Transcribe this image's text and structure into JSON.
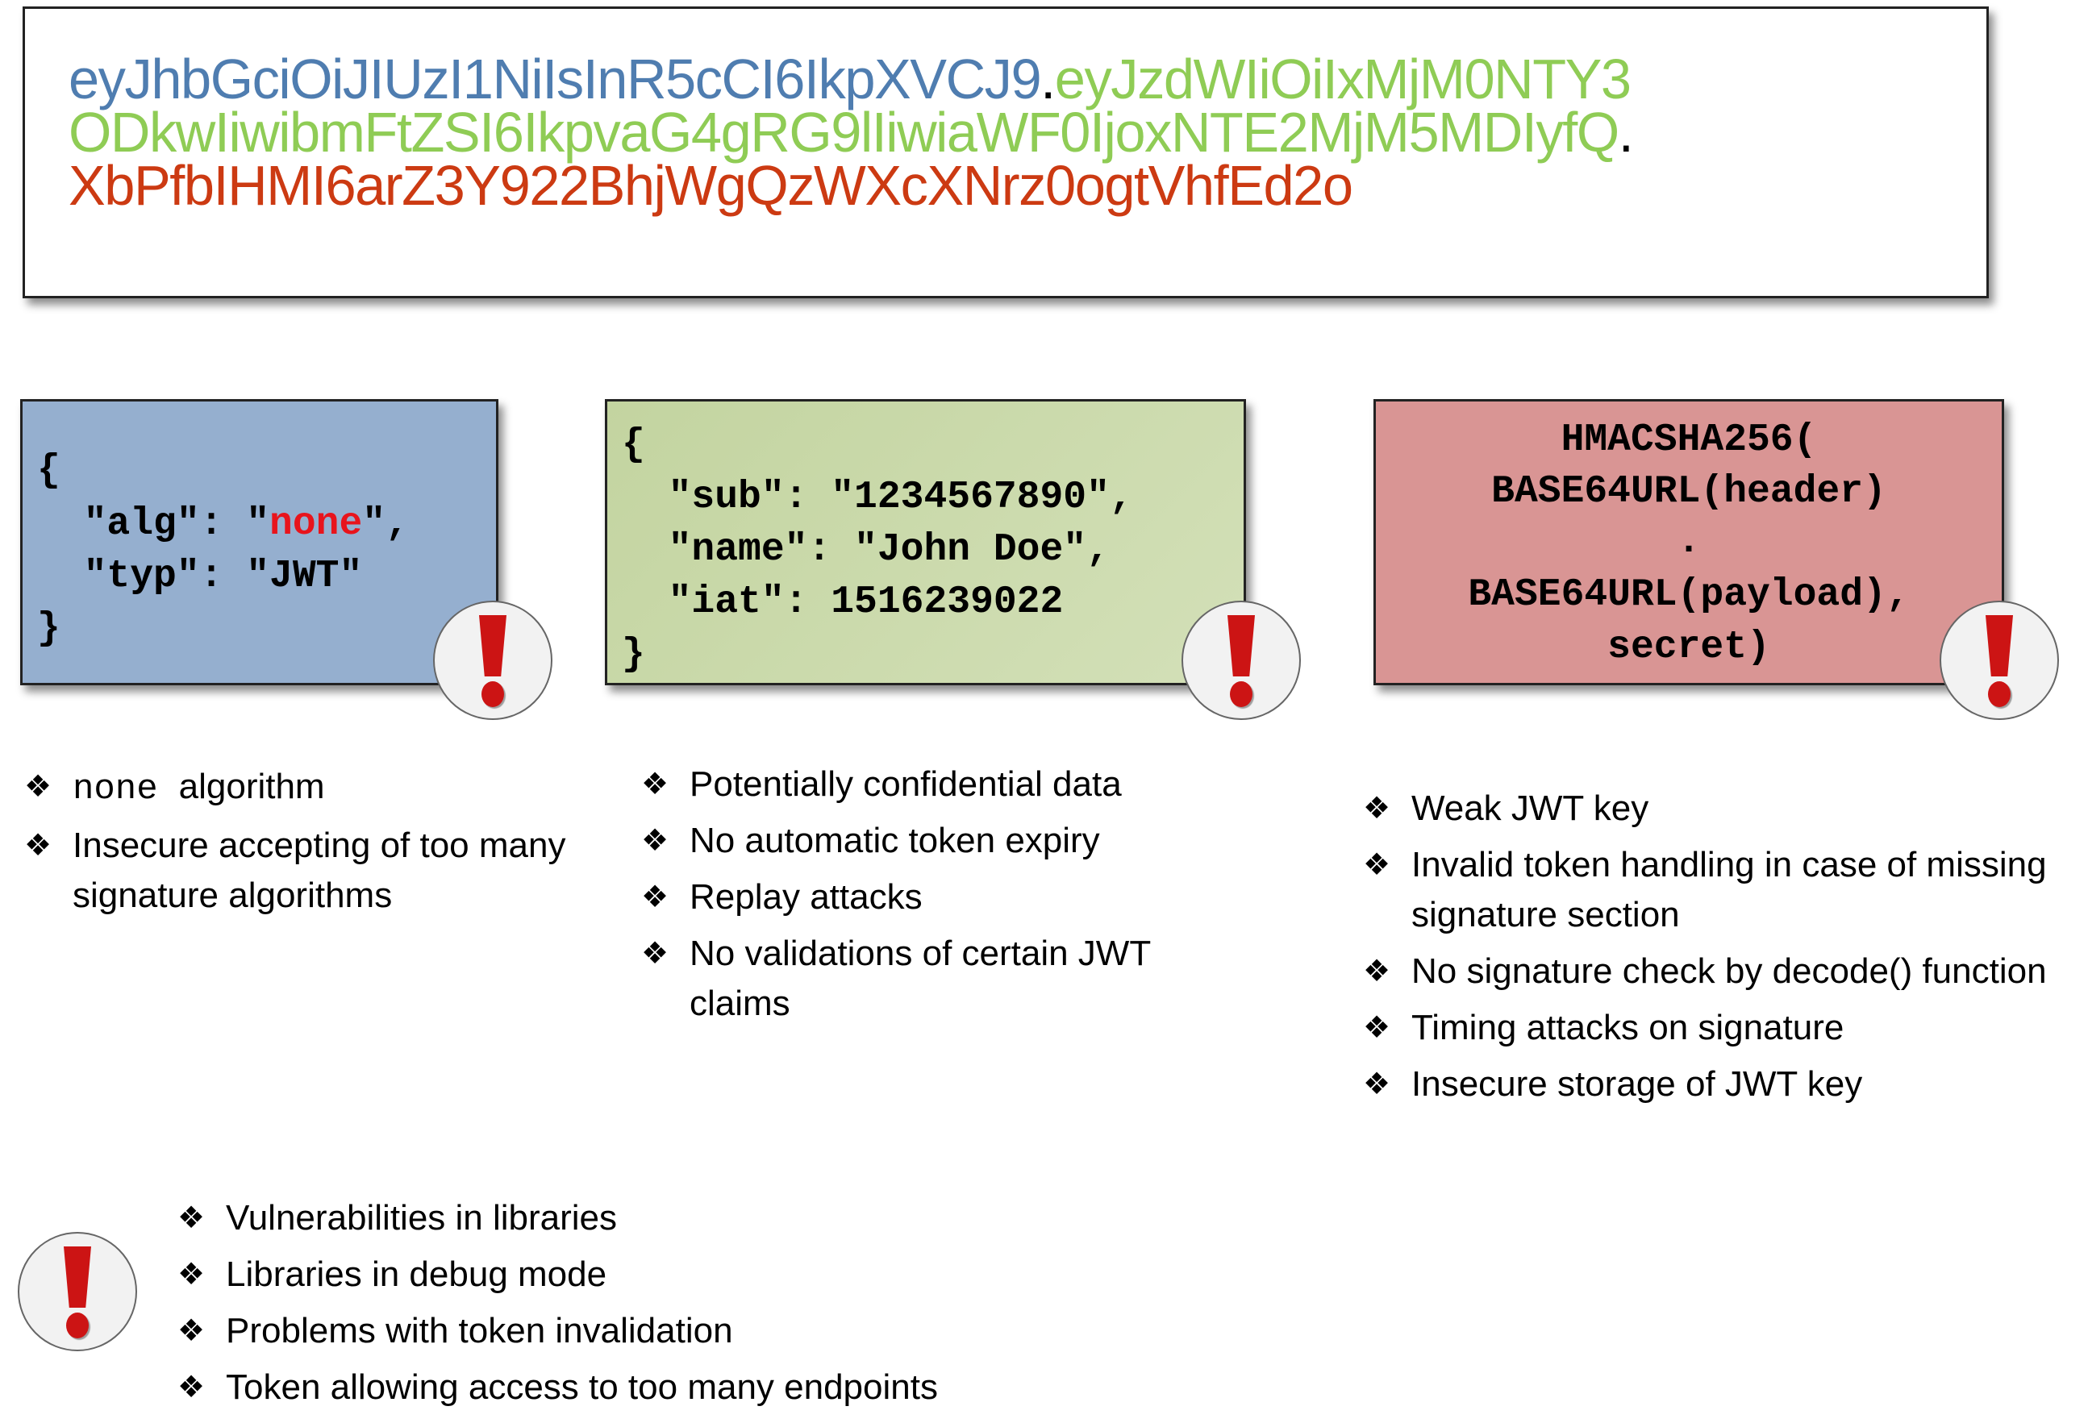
{
  "token": {
    "lines": [
      [
        {
          "text": "eyJhbGciOiJIUzI1NiIsInR5cCI6IkpXVCJ9",
          "part": "header"
        },
        {
          "text": ".",
          "part": "dot"
        },
        {
          "text": "eyJzdWIiOiIxMjM0NTY3",
          "part": "payload"
        }
      ],
      [
        {
          "text": "ODkwIiwibmFtZSI6IkpvaG4gRG9lIiwiaWF0IjoxNTE2MjM5MDIyfQ",
          "part": "payload"
        },
        {
          "text": ".",
          "part": "dot"
        }
      ],
      [
        {
          "text": "XbPfbIHMI6arZ3Y922BhjWgQzWXcXNrz0ogtVhfEd2o",
          "part": "signature"
        }
      ]
    ],
    "colors": {
      "header": "#4f7db0",
      "payload": "#8fcc55",
      "signature": "#cc3a12"
    }
  },
  "header_box": {
    "lines": [
      "{",
      "  \"alg\": \"",
      "  \"typ\": \"JWT\"",
      "}"
    ],
    "alg_value": "none",
    "alg_suffix": "\",",
    "color": "#95afcf",
    "icon": "alert-icon"
  },
  "payload_box": {
    "lines": [
      "{",
      "  \"sub\": \"1234567890\",",
      "  \"name\": \"John Doe\",",
      "  \"iat\": 1516239022",
      "}"
    ],
    "color": "#c9d9a8",
    "icon": "alert-icon"
  },
  "signature_box": {
    "lines": [
      "HMACSHA256(",
      "BASE64URL(header)",
      ".",
      "BASE64URL(payload),",
      "secret)"
    ],
    "color": "#d99594",
    "icon": "alert-icon"
  },
  "header_issues": {
    "bullet_icon": "four-diamond-icon",
    "items": [
      {
        "mono": "none",
        "text": "algorithm"
      },
      {
        "text": "Insecure accepting of too many signature algorithms"
      }
    ]
  },
  "payload_issues": {
    "bullet_icon": "four-diamond-icon",
    "items": [
      "Potentially confidential data",
      "No automatic token expiry",
      "Replay attacks",
      "No validations of certain JWT claims"
    ]
  },
  "signature_issues": {
    "bullet_icon": "four-diamond-icon",
    "items": [
      "Weak JWT key",
      "Invalid token handling in case of missing signature section",
      "No signature check by decode() function",
      "Timing attacks on signature",
      "Insecure storage of JWT key"
    ]
  },
  "general_issues": {
    "icon": "alert-icon",
    "bullet_icon": "four-diamond-icon",
    "items": [
      "Vulnerabilities in libraries",
      "Libraries in debug mode",
      "Problems with token invalidation",
      "Token allowing access to too many endpoints"
    ]
  },
  "alert_color": "#cc1414"
}
